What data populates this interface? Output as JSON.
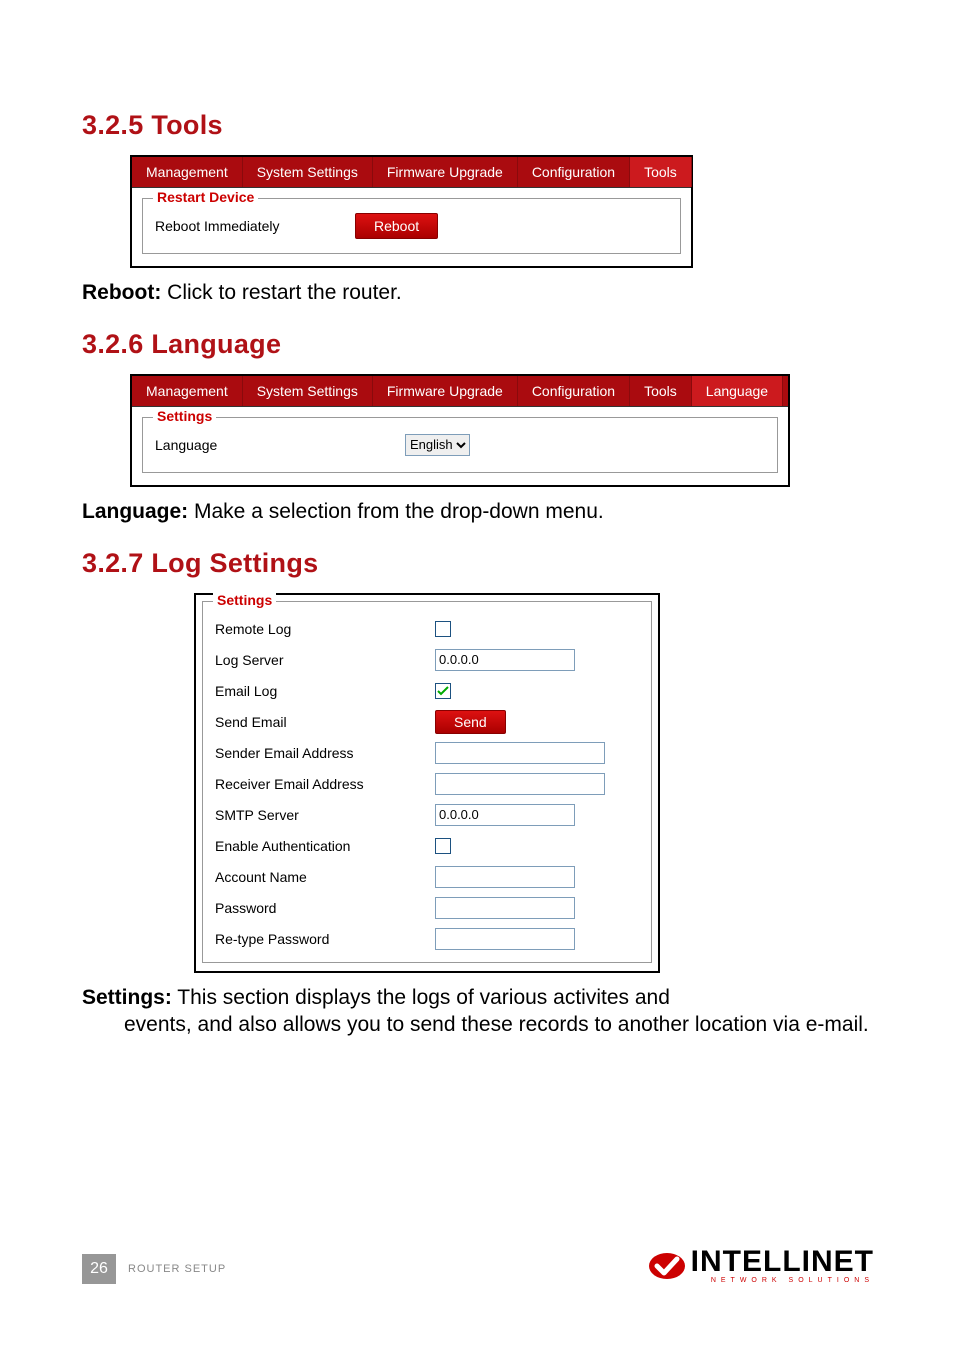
{
  "sections": {
    "tools_heading": "3.2.5  Tools",
    "lang_heading": "3.2.6  Language",
    "log_heading": "3.2.7  Log Settings"
  },
  "tabs_tools": [
    "Management",
    "System Settings",
    "Firmware Upgrade",
    "Configuration",
    "Tools"
  ],
  "tabs_lang": [
    "Management",
    "System Settings",
    "Firmware Upgrade",
    "Configuration",
    "Tools",
    "Language"
  ],
  "tools_panel": {
    "legend": "Restart Device",
    "row_label": "Reboot Immediately",
    "button": "Reboot"
  },
  "lang_panel": {
    "legend": "Settings",
    "row_label": "Language",
    "select_value": "English"
  },
  "log_panel": {
    "legend": "Settings",
    "rows": {
      "remote_log": "Remote Log",
      "log_server": "Log Server",
      "email_log": "Email Log",
      "send_email": "Send Email",
      "sender": "Sender Email Address",
      "receiver": "Receiver Email Address",
      "smtp": "SMTP Server",
      "enable_auth": "Enable Authentication",
      "account": "Account Name",
      "password": "Password",
      "retype": "Re-type Password"
    },
    "values": {
      "log_server": "0.0.0.0",
      "smtp": "0.0.0.0",
      "send_btn": "Send"
    }
  },
  "text": {
    "reboot_label": "Reboot:",
    "reboot_desc": " Click to restart the router.",
    "lang_label": "Language:",
    "lang_desc": " Make a selection from the drop-down menu.",
    "settings_label": "Settings:",
    "settings_desc_1": " This section displays the logs of various activites and",
    "settings_desc_2": "events, and also allows you to send these records to another location via e-mail."
  },
  "footer": {
    "page": "26",
    "label": "ROUTER SETUP",
    "brand": "INTELLINET",
    "brand_sub": "NETWORK SOLUTIONS"
  }
}
